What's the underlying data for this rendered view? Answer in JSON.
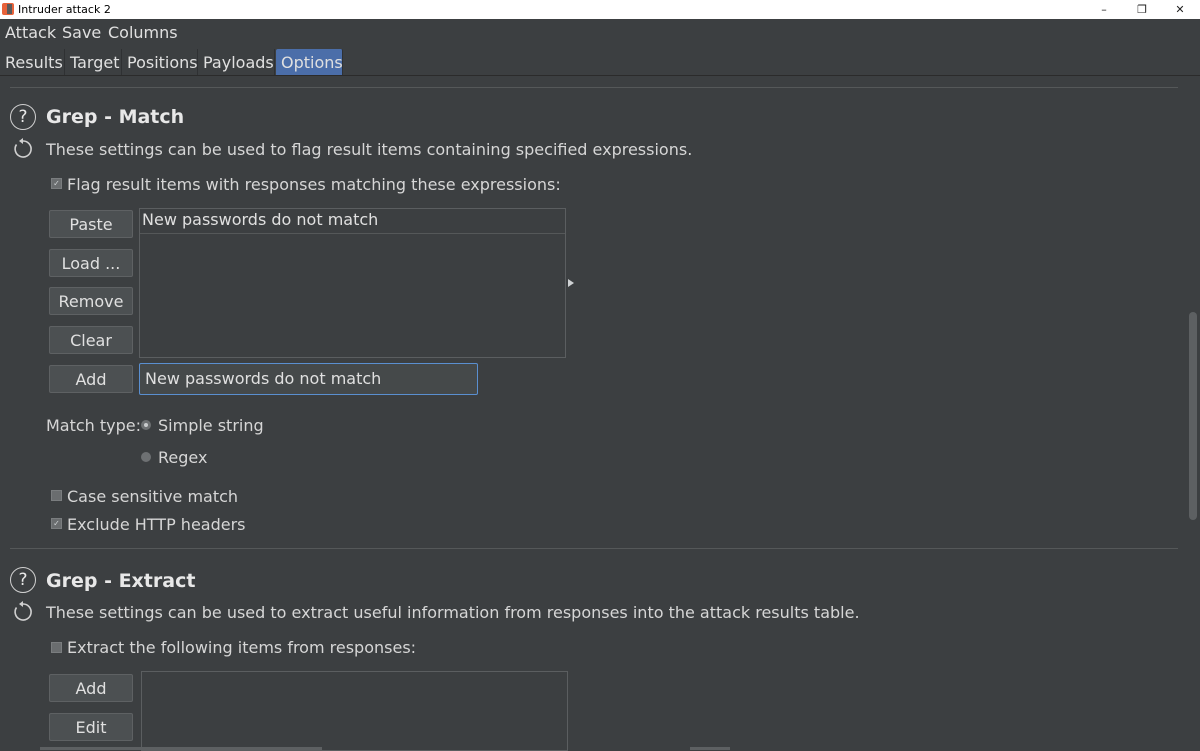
{
  "window": {
    "title": "Intruder attack 2",
    "minimize": "–",
    "restore": "❐",
    "close": "✕"
  },
  "menu": {
    "items": [
      "Attack",
      "Save",
      "Columns"
    ]
  },
  "tabs": [
    "Results",
    "Target",
    "Positions",
    "Payloads",
    "Options"
  ],
  "active_tab": "Options",
  "grep_match": {
    "heading": "Grep - Match",
    "help_icon": "help-circle-icon",
    "reset_icon": "refresh-icon",
    "description": "These settings can be used to flag result items containing specified expressions.",
    "flag_checkbox": {
      "label": "Flag result items with responses matching these expressions:",
      "checked": true
    },
    "buttons": {
      "paste": "Paste",
      "load": "Load ...",
      "remove": "Remove",
      "clear": "Clear",
      "add": "Add"
    },
    "expressions": [
      "New passwords do not match"
    ],
    "input_value": "New passwords do not match",
    "match_type_label": "Match type:",
    "match_types": {
      "simple": "Simple string",
      "regex": "Regex",
      "selected": "Simple string"
    },
    "case_sensitive": {
      "label": "Case sensitive match",
      "checked": false
    },
    "exclude_headers": {
      "label": "Exclude HTTP headers",
      "checked": true
    }
  },
  "grep_extract": {
    "heading": "Grep - Extract",
    "description": "These settings can be used to extract useful information from responses into the attack results table.",
    "extract_checkbox": {
      "label": "Extract the following items from responses:",
      "checked": false
    },
    "buttons": {
      "add": "Add",
      "edit": "Edit"
    }
  },
  "colors": {
    "background": "#3c3f41",
    "active_tab": "#4b6ea9",
    "input_border": "#5a8fd0"
  }
}
